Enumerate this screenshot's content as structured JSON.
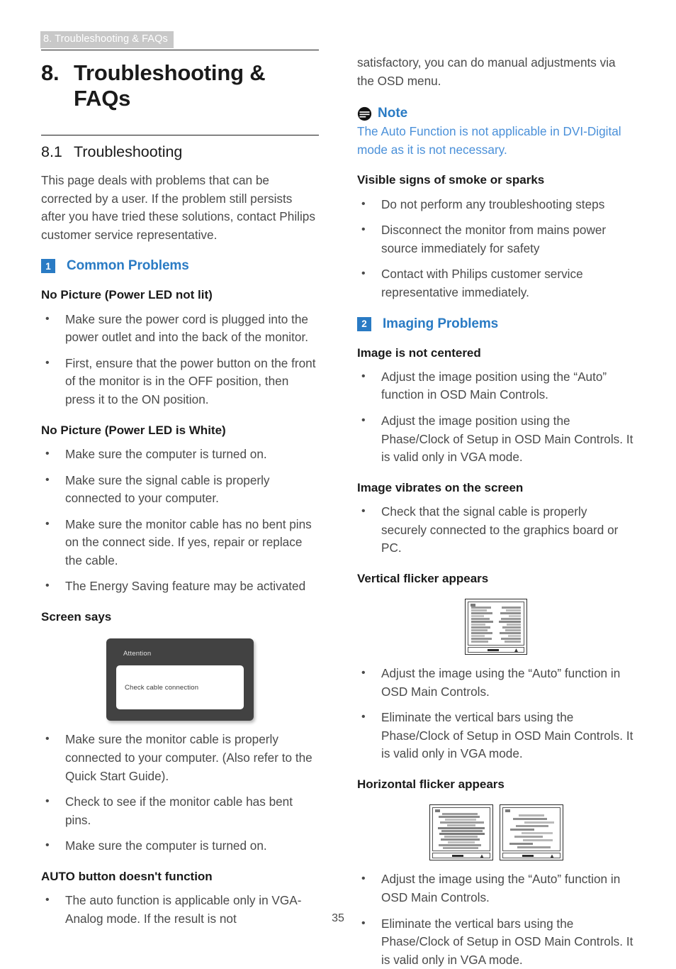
{
  "running_header": "8. Troubleshooting & FAQs",
  "chapter": {
    "number": "8.",
    "title": "Troubleshooting & FAQs"
  },
  "section": {
    "number": "8.1",
    "title": "Troubleshooting"
  },
  "colors": {
    "accent_blue": "#2a7bc4",
    "note_blue": "#4a90d9",
    "header_band": "#c8c8c8",
    "body_text": "#4a4a4a",
    "heading_text": "#1a1a1a",
    "osd_box": "#424242"
  },
  "left_column": {
    "intro": "This page deals with problems that can be corrected by a user. If the problem still persists after you have tried these solutions, contact Philips customer service representative.",
    "group": {
      "number": "1",
      "label": "Common Problems"
    },
    "h_no_picture_not_lit": "No Picture (Power LED not lit)",
    "bullets_not_lit": [
      "Make sure the power cord is plugged into the power outlet and into the back of the monitor.",
      "First, ensure that the power button on the front of the monitor is in the OFF position, then press it to the ON position."
    ],
    "h_no_picture_white": "No Picture (Power LED is White)",
    "bullets_white": [
      "Make sure the computer is turned on.",
      "Make sure the signal cable is properly connected to your computer.",
      "Make sure the monitor cable has no bent pins on the connect side. If yes, repair or replace the cable.",
      "The Energy Saving feature may be activated"
    ],
    "h_screen_says": "Screen says",
    "osd": {
      "title": "Attention",
      "message": "Check cable connection"
    },
    "bullets_screen_says": [
      "Make sure the monitor cable is properly connected to your computer. (Also refer to the Quick Start Guide).",
      "Check to see if the monitor cable has bent pins.",
      "Make sure the computer is turned on."
    ],
    "h_auto_button": "AUTO button doesn't function",
    "bullets_auto_button": [
      "The auto function is applicable only in VGA-Analog mode.  If the result is not"
    ]
  },
  "right_column": {
    "continuation": "satisfactory, you can do manual adjustments via the OSD menu.",
    "note": {
      "label": "Note",
      "body": "The Auto Function is not applicable in DVI-Digital mode as it is not necessary."
    },
    "h_smoke": "Visible signs of smoke or sparks",
    "bullets_smoke": [
      "Do not perform any troubleshooting steps",
      "Disconnect the monitor from mains power source immediately for safety",
      "Contact with Philips customer service representative immediately."
    ],
    "group": {
      "number": "2",
      "label": "Imaging Problems"
    },
    "h_not_centered": "Image is not centered",
    "bullets_not_centered": [
      "Adjust the image position using the “Auto” function in OSD Main Controls.",
      "Adjust the image position using the Phase/Clock of Setup in OSD Main Controls.  It is valid only in VGA mode."
    ],
    "h_vibrates": "Image vibrates on the screen",
    "bullets_vibrates": [
      "Check that the signal cable is properly securely connected to the graphics board or PC."
    ],
    "h_vertical_flicker": "Vertical flicker appears",
    "bullets_vertical_flicker": [
      "Adjust the image using the “Auto” function in OSD Main Controls.",
      "Eliminate the vertical bars using the Phase/Clock of Setup in OSD Main Controls. It is valid only in VGA mode."
    ],
    "h_horizontal_flicker": "Horizontal flicker appears",
    "bullets_horizontal_flicker": [
      "Adjust the image using the “Auto” function in OSD Main Controls.",
      "Eliminate the vertical bars using the Phase/Clock of Setup in OSD Main Controls. It is valid only in VGA mode."
    ]
  },
  "page_number": "35"
}
